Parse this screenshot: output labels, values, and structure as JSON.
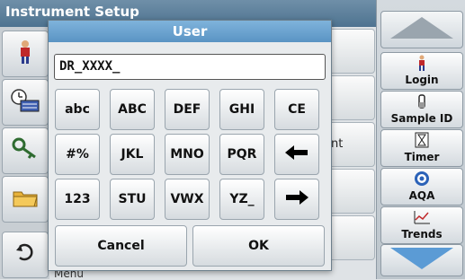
{
  "background": {
    "title": "Instrument Setup",
    "list_partial_text": "nt",
    "menu_label": "Menu"
  },
  "right_panel": {
    "buttons": [
      {
        "label": "Login",
        "icon": "person-icon"
      },
      {
        "label": "Sample ID",
        "icon": "vial-icon"
      },
      {
        "label": "Timer",
        "icon": "hourglass-icon"
      },
      {
        "label": "AQA",
        "icon": "target-icon"
      },
      {
        "label": "Trends",
        "icon": "chart-icon"
      }
    ]
  },
  "dialog": {
    "title": "User",
    "input_value": "DR_XXXX_",
    "keys": {
      "row1": [
        "abc",
        "ABC",
        "DEF",
        "GHI",
        "CE"
      ],
      "row2": [
        "#%",
        "JKL",
        "MNO",
        "PQR"
      ],
      "row3": [
        "123",
        "STU",
        "VWX",
        "YZ_"
      ]
    },
    "cancel_label": "Cancel",
    "ok_label": "OK"
  },
  "colors": {
    "accent": "#5a94c4",
    "titlebar": "#4e7390",
    "scroll_arrow": "#5b9bd5"
  }
}
